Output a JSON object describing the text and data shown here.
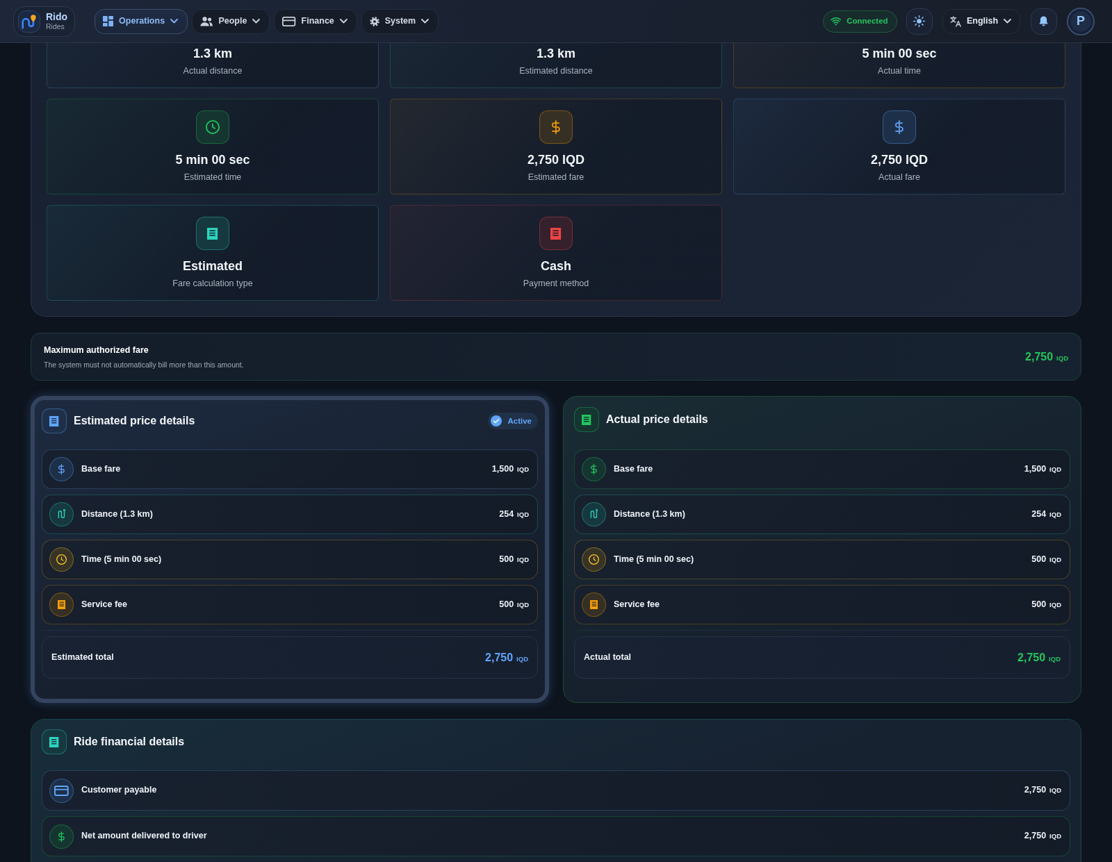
{
  "navbar": {
    "brand": {
      "name": "Rido",
      "subtitle": "Rides"
    },
    "menu": [
      {
        "label": "Operations",
        "kind": "grid",
        "selected": true
      },
      {
        "label": "People",
        "kind": "people",
        "selected": false
      },
      {
        "label": "Finance",
        "kind": "card",
        "selected": false
      },
      {
        "label": "System",
        "kind": "gear",
        "selected": false
      }
    ],
    "connection": {
      "label": "Connected",
      "online": true
    },
    "language": {
      "label": "English"
    },
    "avatar": {
      "initial": "P"
    }
  },
  "trip_stats": [
    {
      "value": "1.3 km",
      "label": "Actual distance",
      "color": "#27425a"
    },
    {
      "value": "1.3 km",
      "label": "Estimated distance",
      "color": "#1f4748"
    },
    {
      "value": "5 min 00 sec",
      "label": "Actual time",
      "color": "#4d3d22"
    },
    {
      "value": "5 min 00 sec",
      "label": "Estimated time",
      "color": "#22c55e",
      "kind": "clock"
    },
    {
      "value": "2,750 IQD",
      "label": "Estimated fare",
      "color": "#f59e0b",
      "kind": "dollar"
    },
    {
      "value": "2,750 IQD",
      "label": "Actual fare",
      "color": "#60a5fa",
      "kind": "dollar"
    },
    {
      "value": "Estimated",
      "label": "Fare calculation type",
      "color": "#2dd4bf",
      "kind": "receipt"
    },
    {
      "value": "Cash",
      "label": "Payment method",
      "color": "#ef4444",
      "kind": "receipt"
    }
  ],
  "fare_cap": {
    "title": "Maximum authorized fare",
    "description": "The system must not automatically bill more than this amount.",
    "amount": "2,750",
    "currency": "IQD"
  },
  "price_panels": [
    {
      "title": "Estimated price details",
      "color": "#60a5fa",
      "active": true,
      "badge": "Active",
      "items": [
        {
          "label": "Base fare",
          "amount": "1,500",
          "currency": "IQD",
          "kind": "dollar",
          "color": "#60a5fa"
        },
        {
          "label": "Distance (1.3 km)",
          "amount": "254",
          "currency": "IQD",
          "kind": "route",
          "color": "#2dd4bf"
        },
        {
          "label": "Time (5 min 00 sec)",
          "amount": "500",
          "currency": "IQD",
          "kind": "clock",
          "color": "#fbbf24"
        },
        {
          "label": "Service fee",
          "amount": "500",
          "currency": "IQD",
          "kind": "receipt",
          "color": "#f59e0b"
        }
      ],
      "total": {
        "label": "Estimated total",
        "amount": "2,750",
        "currency": "IQD"
      }
    },
    {
      "title": "Actual price details",
      "color": "#22c55e",
      "active": false,
      "items": [
        {
          "label": "Base fare",
          "amount": "1,500",
          "currency": "IQD",
          "kind": "dollar",
          "color": "#22c55e"
        },
        {
          "label": "Distance (1.3 km)",
          "amount": "254",
          "currency": "IQD",
          "kind": "route",
          "color": "#2dd4bf"
        },
        {
          "label": "Time (5 min 00 sec)",
          "amount": "500",
          "currency": "IQD",
          "kind": "clock",
          "color": "#fbbf24"
        },
        {
          "label": "Service fee",
          "amount": "500",
          "currency": "IQD",
          "kind": "receipt",
          "color": "#f59e0b"
        }
      ],
      "total": {
        "label": "Actual total",
        "amount": "2,750",
        "currency": "IQD"
      }
    }
  ],
  "financial_details": {
    "title": "Ride financial details",
    "color": "#2dd4bf",
    "items": [
      {
        "label": "Customer payable",
        "amount": "2,750",
        "currency": "IQD",
        "kind": "card",
        "color": "#60a5fa"
      },
      {
        "label": "Net amount delivered to driver",
        "amount": "2,750",
        "currency": "IQD",
        "kind": "dollar",
        "color": "#22c55e"
      }
    ]
  }
}
